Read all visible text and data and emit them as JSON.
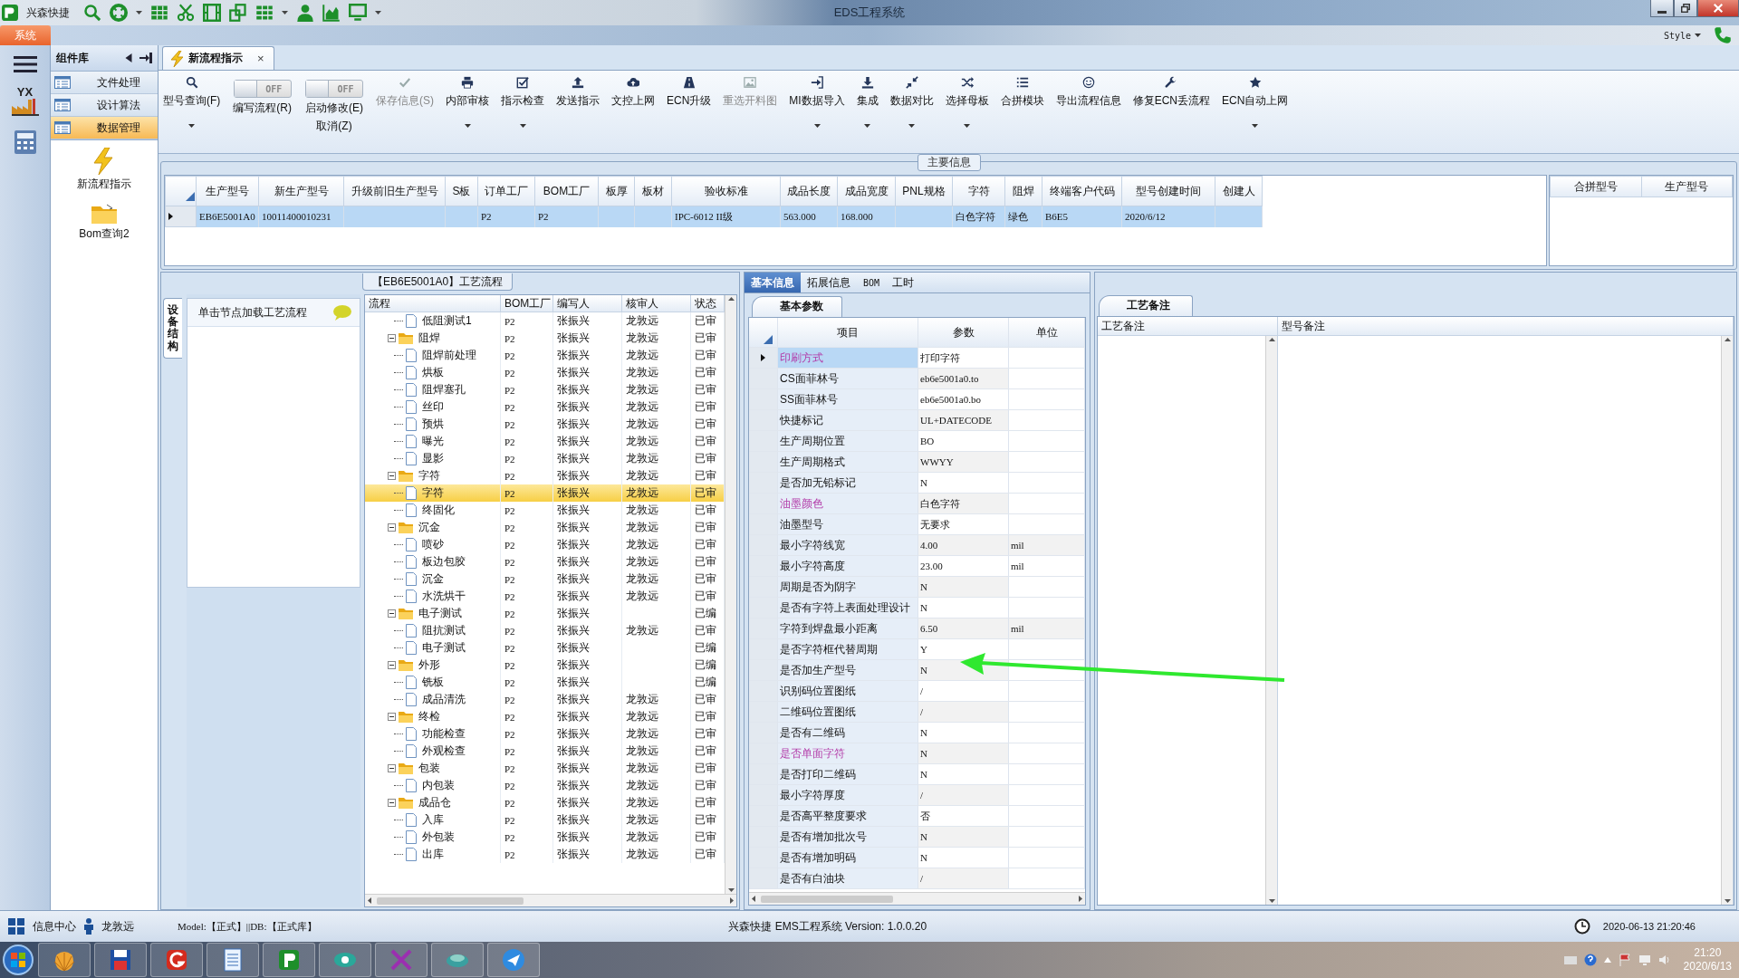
{
  "window": {
    "app_name": "兴森快捷",
    "title": "EDS工程系统"
  },
  "ribbon": {
    "menu_tab": "系统",
    "style_menu": "Style"
  },
  "left_strip": {
    "logo_text": "YX"
  },
  "components": {
    "title": "组件库",
    "items": [
      {
        "label": "文件处理",
        "selected": false
      },
      {
        "label": "设计算法",
        "selected": false
      },
      {
        "label": "数据管理",
        "selected": true
      }
    ],
    "shortcuts": [
      {
        "label": "新流程指示"
      },
      {
        "label": "Bom查询2"
      }
    ]
  },
  "document_tab": {
    "label": "新流程指示",
    "close": "×"
  },
  "toolbar": [
    {
      "kind": "button",
      "label": "型号查询(F)",
      "dropdown": true,
      "disabled": false
    },
    {
      "kind": "toggle",
      "label": "编写流程(R)",
      "switch_text": "OFF",
      "on": false
    },
    {
      "kind": "toggle",
      "label": "启动修改(E)",
      "second_label": "取消(Z)",
      "switch_text": "OFF",
      "on": false
    },
    {
      "kind": "button",
      "label": "保存信息(S)",
      "dropdown": false,
      "disabled": true
    },
    {
      "kind": "button",
      "label": "内部审核",
      "dropdown": true,
      "disabled": false
    },
    {
      "kind": "button",
      "label": "指示检查",
      "dropdown": true,
      "disabled": false
    },
    {
      "kind": "button",
      "label": "发送指示",
      "dropdown": false,
      "disabled": false
    },
    {
      "kind": "button",
      "label": "文控上网",
      "dropdown": false,
      "disabled": false
    },
    {
      "kind": "button",
      "label": "ECN升级",
      "dropdown": false,
      "disabled": false
    },
    {
      "kind": "button",
      "label": "重选开料图",
      "dropdown": false,
      "disabled": true
    },
    {
      "kind": "button",
      "label": "MI数据导入",
      "dropdown": true,
      "disabled": false
    },
    {
      "kind": "button",
      "label": "集成",
      "dropdown": true,
      "disabled": false
    },
    {
      "kind": "button",
      "label": "数据对比",
      "dropdown": true,
      "disabled": false
    },
    {
      "kind": "button",
      "label": "选择母板",
      "dropdown": true,
      "disabled": false
    },
    {
      "kind": "button",
      "label": "合拼模块",
      "dropdown": false,
      "disabled": false
    },
    {
      "kind": "button",
      "label": "导出流程信息",
      "dropdown": false,
      "disabled": false
    },
    {
      "kind": "button",
      "label": "修复ECN丢流程",
      "dropdown": false,
      "disabled": false
    },
    {
      "kind": "button",
      "label": "ECN自动上网",
      "dropdown": true,
      "disabled": false
    }
  ],
  "main_info": {
    "title": "主要信息",
    "columns": [
      "生产型号",
      "新生产型号",
      "升级前旧生产型号",
      "S板",
      "订单工厂",
      "BOM工厂",
      "板厚",
      "板材",
      "验收标准",
      "成品长度",
      "成品宽度",
      "PNL规格",
      "字符",
      "阻焊",
      "终端客户代码",
      "型号创建时间",
      "创建人"
    ],
    "rows": [
      {
        "selected": true,
        "cells": [
          "EB6E5001A0",
          "10011400010231",
          null,
          null,
          "P2",
          "P2",
          null,
          null,
          "IPC-6012 II级",
          "563.000",
          "168.000",
          null,
          "白色字符",
          "绿色",
          "B6E5",
          "2020/6/12",
          null
        ]
      }
    ],
    "merge_table": {
      "columns": [
        "合拼型号",
        "生产型号"
      ]
    }
  },
  "process_flow": {
    "title": "【EB6E5001A0】工艺流程",
    "side_tab": "设备结构",
    "hint": "单击节点加载工艺流程",
    "columns": [
      "流程",
      "BOM工厂",
      "编写人",
      "核审人",
      "状态"
    ],
    "nodes": [
      {
        "children": [
          {
            "name": "低阻测试1",
            "bom": "P2",
            "author": "张振兴",
            "reviewer": "龙敦远",
            "status": "已审",
            "selected": false
          }
        ]
      },
      {
        "name": "阻焊",
        "bom": "P2",
        "author": "张振兴",
        "reviewer": "龙敦远",
        "status": "已审",
        "selected": false,
        "expanded": true,
        "children": [
          {
            "name": "阻焊前处理",
            "bom": "P2",
            "author": "张振兴",
            "reviewer": "龙敦远",
            "status": "已审",
            "selected": false
          },
          {
            "name": "烘板",
            "bom": "P2",
            "author": "张振兴",
            "reviewer": "龙敦远",
            "status": "已审",
            "selected": false
          },
          {
            "name": "阻焊塞孔",
            "bom": "P2",
            "author": "张振兴",
            "reviewer": "龙敦远",
            "status": "已审",
            "selected": false
          },
          {
            "name": "丝印",
            "bom": "P2",
            "author": "张振兴",
            "reviewer": "龙敦远",
            "status": "已审",
            "selected": false
          },
          {
            "name": "预烘",
            "bom": "P2",
            "author": "张振兴",
            "reviewer": "龙敦远",
            "status": "已审",
            "selected": false
          },
          {
            "name": "曝光",
            "bom": "P2",
            "author": "张振兴",
            "reviewer": "龙敦远",
            "status": "已审",
            "selected": false
          },
          {
            "name": "显影",
            "bom": "P2",
            "author": "张振兴",
            "reviewer": "龙敦远",
            "status": "已审",
            "selected": false
          }
        ]
      },
      {
        "name": "字符",
        "bom": "P2",
        "author": "张振兴",
        "reviewer": "龙敦远",
        "status": "已审",
        "selected": false,
        "expanded": true,
        "children": [
          {
            "name": "字符",
            "bom": "P2",
            "author": "张振兴",
            "reviewer": "龙敦远",
            "status": "已审",
            "selected": true
          },
          {
            "name": "终固化",
            "bom": "P2",
            "author": "张振兴",
            "reviewer": "龙敦远",
            "status": "已审",
            "selected": false
          }
        ]
      },
      {
        "name": "沉金",
        "bom": "P2",
        "author": "张振兴",
        "reviewer": "龙敦远",
        "status": "已审",
        "selected": false,
        "expanded": true,
        "children": [
          {
            "name": "喷砂",
            "bom": "P2",
            "author": "张振兴",
            "reviewer": "龙敦远",
            "status": "已审",
            "selected": false
          },
          {
            "name": "板边包胶",
            "bom": "P2",
            "author": "张振兴",
            "reviewer": "龙敦远",
            "status": "已审",
            "selected": false
          },
          {
            "name": "沉金",
            "bom": "P2",
            "author": "张振兴",
            "reviewer": "龙敦远",
            "status": "已审",
            "selected": false
          },
          {
            "name": "水洗烘干",
            "bom": "P2",
            "author": "张振兴",
            "reviewer": "龙敦远",
            "status": "已审",
            "selected": false
          }
        ]
      },
      {
        "name": "电子测试",
        "bom": "P2",
        "author": "张振兴",
        "status": "已编",
        "selected": false,
        "expanded": true,
        "children": [
          {
            "name": "阻抗测试",
            "bom": "P2",
            "author": "张振兴",
            "reviewer": "龙敦远",
            "status": "已审",
            "selected": false
          },
          {
            "name": "电子测试",
            "bom": "P2",
            "author": "张振兴",
            "status": "已编",
            "selected": false
          }
        ]
      },
      {
        "name": "外形",
        "bom": "P2",
        "author": "张振兴",
        "status": "已编",
        "selected": false,
        "expanded": true,
        "children": [
          {
            "name": "铣板",
            "bom": "P2",
            "author": "张振兴",
            "status": "已编",
            "selected": false
          },
          {
            "name": "成品清洗",
            "bom": "P2",
            "author": "张振兴",
            "reviewer": "龙敦远",
            "status": "已审",
            "selected": false
          }
        ]
      },
      {
        "name": "终检",
        "bom": "P2",
        "author": "张振兴",
        "reviewer": "龙敦远",
        "status": "已审",
        "selected": false,
        "expanded": true,
        "children": [
          {
            "name": "功能检查",
            "bom": "P2",
            "author": "张振兴",
            "reviewer": "龙敦远",
            "status": "已审",
            "selected": false
          },
          {
            "name": "外观检查",
            "bom": "P2",
            "author": "张振兴",
            "reviewer": "龙敦远",
            "status": "已审",
            "selected": false
          }
        ]
      },
      {
        "name": "包装",
        "bom": "P2",
        "author": "张振兴",
        "reviewer": "龙敦远",
        "status": "已审",
        "selected": false,
        "expanded": true,
        "children": [
          {
            "name": "内包装",
            "bom": "P2",
            "author": "张振兴",
            "reviewer": "龙敦远",
            "status": "已审",
            "selected": false
          }
        ]
      },
      {
        "name": "成品仓",
        "bom": "P2",
        "author": "张振兴",
        "reviewer": "龙敦远",
        "status": "已审",
        "selected": false,
        "expanded": true,
        "children": [
          {
            "name": "入库",
            "bom": "P2",
            "author": "张振兴",
            "reviewer": "龙敦远",
            "status": "已审",
            "selected": false
          },
          {
            "name": "外包装",
            "bom": "P2",
            "author": "张振兴",
            "reviewer": "龙敦远",
            "status": "已审",
            "selected": false
          },
          {
            "name": "出库",
            "bom": "P2",
            "author": "张振兴",
            "reviewer": "龙敦远",
            "status": "已审",
            "selected": false
          }
        ]
      }
    ]
  },
  "details": {
    "tabs": [
      {
        "label": "基本信息",
        "selected": true
      },
      {
        "label": "拓展信息",
        "selected": false
      },
      {
        "label": "BOM",
        "selected": false
      },
      {
        "label": "工时",
        "selected": false
      }
    ],
    "subtab": "基本参数",
    "columns": [
      "项目",
      "参数",
      "单位"
    ],
    "rows": [
      {
        "item": "印刷方式",
        "value": "打印字符",
        "highlighted": true,
        "selected": true
      },
      {
        "item": "CS面菲林号",
        "value": "eb6e5001a0.to",
        "highlighted": false,
        "selected": false
      },
      {
        "item": "SS面菲林号",
        "value": "eb6e5001a0.bo",
        "highlighted": false,
        "selected": false
      },
      {
        "item": "快捷标记",
        "value": "UL+DATECODE",
        "highlighted": false,
        "selected": false
      },
      {
        "item": "生产周期位置",
        "value": "BO",
        "highlighted": false,
        "selected": false
      },
      {
        "item": "生产周期格式",
        "value": "WWYY",
        "highlighted": false,
        "selected": false
      },
      {
        "item": "是否加无铅标记",
        "value": "N",
        "highlighted": false,
        "selected": false
      },
      {
        "item": "油墨颜色",
        "value": "白色字符",
        "highlighted": true,
        "selected": false
      },
      {
        "item": "油墨型号",
        "value": "无要求",
        "highlighted": false,
        "selected": false
      },
      {
        "item": "最小字符线宽",
        "value": "4.00",
        "unit": "mil",
        "highlighted": false,
        "selected": false
      },
      {
        "item": "最小字符高度",
        "value": "23.00",
        "unit": "mil",
        "highlighted": false,
        "selected": false
      },
      {
        "item": "周期是否为阴字",
        "value": "N",
        "highlighted": false,
        "selected": false
      },
      {
        "item": "是否有字符上表面处理设计",
        "value": "N",
        "highlighted": false,
        "selected": false
      },
      {
        "item": "字符到焊盘最小距离",
        "value": "6.50",
        "unit": "mil",
        "highlighted": false,
        "selected": false
      },
      {
        "item": "是否字符框代替周期",
        "value": "Y",
        "highlighted": false,
        "selected": false
      },
      {
        "item": "是否加生产型号",
        "value": "N",
        "highlighted": false,
        "selected": false
      },
      {
        "item": "识别码位置图纸",
        "value": "/",
        "highlighted": false,
        "selected": false
      },
      {
        "item": "二维码位置图纸",
        "value": "/",
        "highlighted": false,
        "selected": false
      },
      {
        "item": "是否有二维码",
        "value": "N",
        "highlighted": false,
        "selected": false
      },
      {
        "item": "是否单面字符",
        "value": "N",
        "highlighted": true,
        "selected": false
      },
      {
        "item": "是否打印二维码",
        "value": "N",
        "highlighted": false,
        "selected": false
      },
      {
        "item": "最小字符厚度",
        "value": "/",
        "highlighted": false,
        "selected": false
      },
      {
        "item": "是否高平整度要求",
        "value": "否",
        "highlighted": false,
        "selected": false
      },
      {
        "item": "是否有增加批次号",
        "value": "N",
        "highlighted": false,
        "selected": false
      },
      {
        "item": "是否有增加明码",
        "value": "N",
        "highlighted": false,
        "selected": false
      },
      {
        "item": "是否有白油块",
        "value": "/",
        "highlighted": false,
        "selected": false
      }
    ]
  },
  "notes": {
    "tab": "工艺备注",
    "columns": [
      "工艺备注",
      "型号备注"
    ]
  },
  "status_bar": {
    "info_center": "信息中心",
    "user": "龙敦远",
    "model": "Model:【正式】||DB:【正式库】",
    "version": "兴森快捷 EMS工程系统 Version: 1.0.0.20",
    "datetime": "2020-06-13 21:20:46"
  },
  "taskbar": {
    "time": "21:20",
    "date": "2020/6/13"
  }
}
